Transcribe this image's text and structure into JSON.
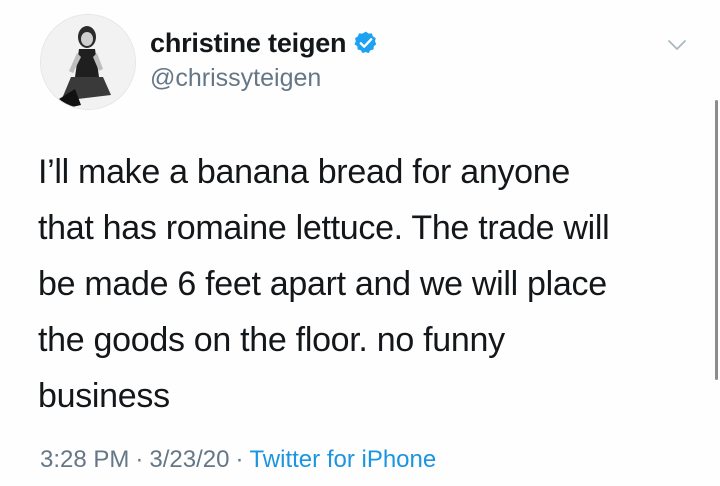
{
  "tweet": {
    "author": {
      "display_name": "christine teigen",
      "handle": "@chrissyteigen",
      "verified": true
    },
    "text": "I’ll make a banana bread for anyone\nthat has romaine lettuce. The trade will\nbe made 6 feet apart and we will place\nthe goods on the floor. no funny\nbusiness",
    "time": "3:28 PM",
    "date": "3/23/20",
    "separator": "·",
    "source": "Twitter for iPhone"
  },
  "colors": {
    "text": "#14171a",
    "secondary": "#657786",
    "link": "#1b95e0",
    "verified_badge": "#1da1f2"
  },
  "icons": {
    "verified": "verified-badge-icon",
    "menu": "chevron-down-icon"
  }
}
